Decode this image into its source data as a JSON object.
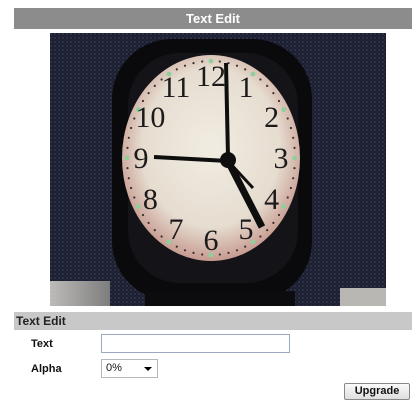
{
  "header": {
    "title": "Text Edit"
  },
  "preview": {
    "content": "analog-wall-clock",
    "dial_numerals": [
      "12",
      "1",
      "2",
      "3",
      "4",
      "5",
      "6",
      "7",
      "8",
      "9",
      "10",
      "11"
    ]
  },
  "section": {
    "title": "Text Edit"
  },
  "form": {
    "text_label": "Text",
    "text_value": "",
    "alpha_label": "Alpha",
    "alpha_value": "0%"
  },
  "actions": {
    "upgrade_label": "Upgrade"
  }
}
